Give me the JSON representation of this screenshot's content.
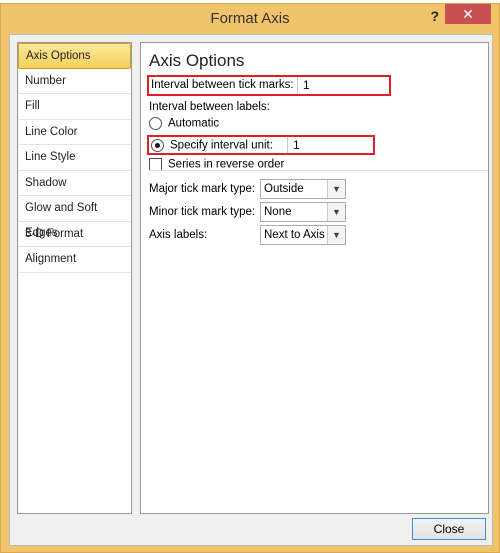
{
  "window": {
    "title": "Format Axis",
    "help_label": "?",
    "close_glyph": "✕"
  },
  "nav": {
    "items": [
      {
        "label": "Axis Options",
        "selected": true
      },
      {
        "label": "Number"
      },
      {
        "label": "Fill"
      },
      {
        "label": "Line Color"
      },
      {
        "label": "Line Style"
      },
      {
        "label": "Shadow"
      },
      {
        "label": "Glow and Soft Edges"
      },
      {
        "label": "3-D Format"
      },
      {
        "label": "Alignment"
      }
    ]
  },
  "panel": {
    "heading": "Axis Options",
    "tick_interval_label": "Interval between tick marks:",
    "tick_interval_value": "1",
    "labels_interval_label": "Interval between labels:",
    "automatic_label": "Automatic",
    "automatic_checked": false,
    "specify_label": "Specify interval unit:",
    "specify_checked": true,
    "specify_value": "1",
    "reverse_label": "Series in reverse order",
    "reverse_checked": false,
    "major_label": "Major tick mark type:",
    "major_value": "Outside",
    "minor_label": "Minor tick mark type:",
    "minor_value": "None",
    "axis_labels_label": "Axis labels:",
    "axis_labels_value": "Next to Axis"
  },
  "footer": {
    "close_label": "Close"
  },
  "colors": {
    "frame": "#efc46a",
    "highlight": "#e01e2a",
    "close_button": "#c75050"
  }
}
